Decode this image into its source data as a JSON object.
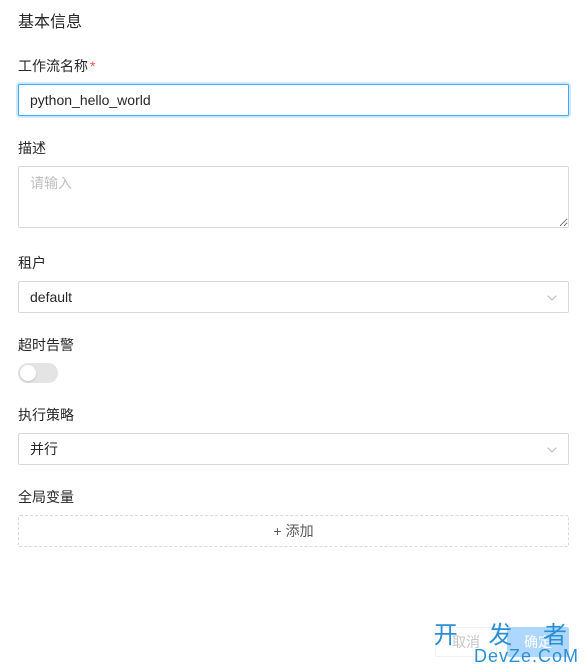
{
  "section_title": "基本信息",
  "fields": {
    "workflow_name": {
      "label": "工作流名称",
      "value": "python_hello_world"
    },
    "description": {
      "label": "描述",
      "placeholder": "请输入",
      "value": ""
    },
    "tenant": {
      "label": "租户",
      "value": "default"
    },
    "timeout_alarm": {
      "label": "超时告警",
      "value": false
    },
    "execution_strategy": {
      "label": "执行策略",
      "value": "并行"
    },
    "global_vars": {
      "label": "全局变量",
      "add_button": "添加"
    }
  },
  "footer": {
    "cancel": "取消",
    "confirm": "确定"
  },
  "watermark": {
    "line1": "开 发 者",
    "line2": "DevZe.CoM"
  }
}
